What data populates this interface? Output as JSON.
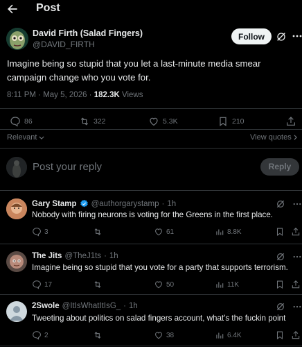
{
  "header": {
    "title": "Post"
  },
  "post": {
    "author": {
      "name": "David Firth (Salad Fingers)",
      "handle": "@DAVID_FIRTH"
    },
    "follow_label": "Follow",
    "text": "Imagine being so stupid that you let a last-minute media smear campaign change who you vote for.",
    "time": "8:11 PM · May 5, 2026 · ",
    "views_count": "182.3K",
    "views_label": " Views",
    "stats": {
      "replies": "86",
      "reposts": "322",
      "likes": "5.3K",
      "bookmarks": "210"
    }
  },
  "sort": {
    "label": "Relevant",
    "view_quotes": "View quotes"
  },
  "composer": {
    "placeholder": "Post your reply",
    "button": "Reply"
  },
  "replies": [
    {
      "name": "Gary Stamp",
      "verified": true,
      "handle": "@authorgarystamp",
      "time": "1h",
      "text": "Nobody with firing neurons is voting for the Greens in the first place.",
      "replies": "3",
      "reposts": "",
      "likes": "61",
      "views": "8.8K"
    },
    {
      "name": "The Jits",
      "verified": false,
      "handle": "@TheJ1ts",
      "time": "1h",
      "text": "Imagine being so stupid that you vote for a party that supports terrorism.",
      "replies": "17",
      "reposts": "",
      "likes": "50",
      "views": "11K"
    },
    {
      "name": "2Swole",
      "verified": false,
      "handle": "@ItIsWhatItIsG_",
      "time": "1h",
      "text": "Tweeting about politics on salad fingers account, what's the fuckin point",
      "replies": "2",
      "reposts": "",
      "likes": "38",
      "views": "6.4K"
    }
  ],
  "colors": {
    "background": "#000000",
    "text": "#e7e9ea",
    "muted": "#71767b",
    "divider": "#2f3336",
    "verified": "#1d9bf0",
    "follow_bg": "#eff3f4"
  },
  "icons": [
    "back-arrow-icon",
    "grok-icon",
    "more-icon",
    "reply-icon",
    "repost-icon",
    "like-icon",
    "bookmark-icon",
    "share-icon",
    "views-icon",
    "chevron-down-icon",
    "verified-badge-icon"
  ]
}
